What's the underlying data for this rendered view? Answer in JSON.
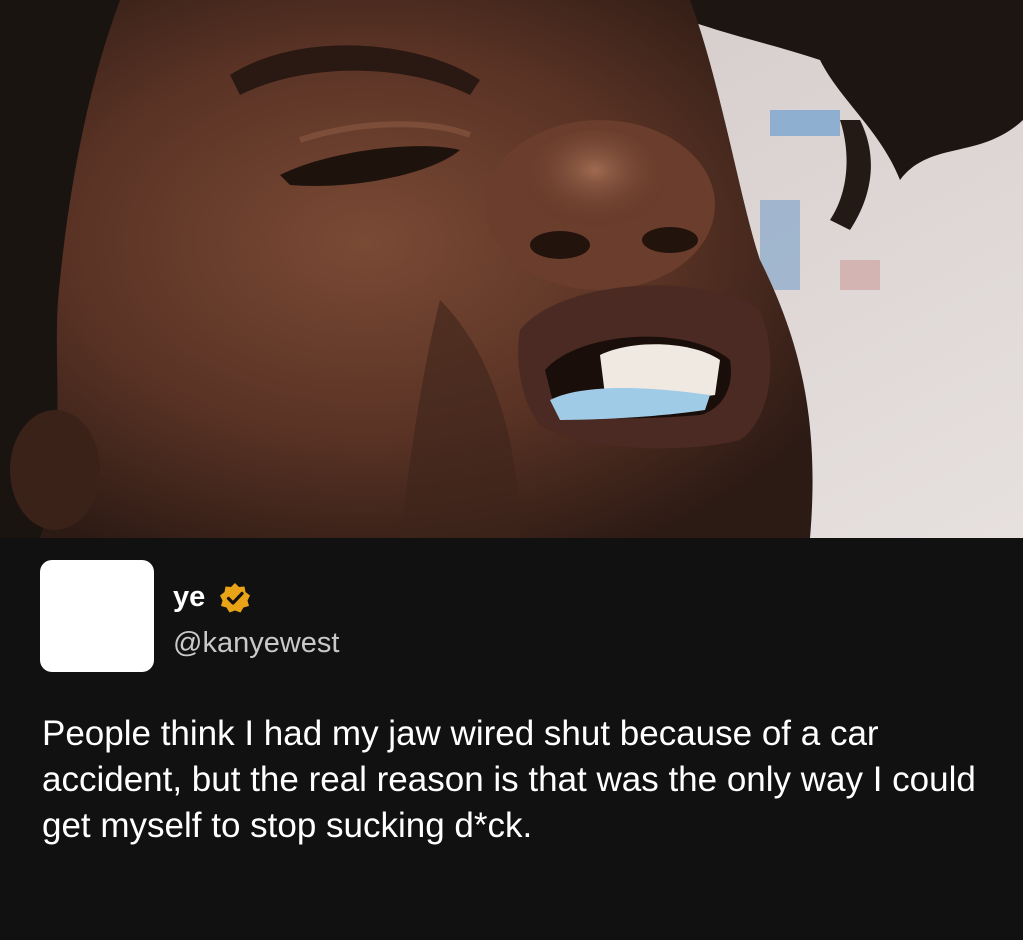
{
  "tweet": {
    "display_name": "ye",
    "handle": "@kanyewest",
    "verified_icon": "verified-badge-icon",
    "verified_color": "#e8a317",
    "text": "People think I had my jaw wired shut because of a car accident, but the real reason is that was the only way I could get myself to stop sucking d*ck."
  },
  "colors": {
    "panel_background": "#111111",
    "text": "#ffffff",
    "handle": "#c9c9c9",
    "avatar": "#ffffff"
  }
}
